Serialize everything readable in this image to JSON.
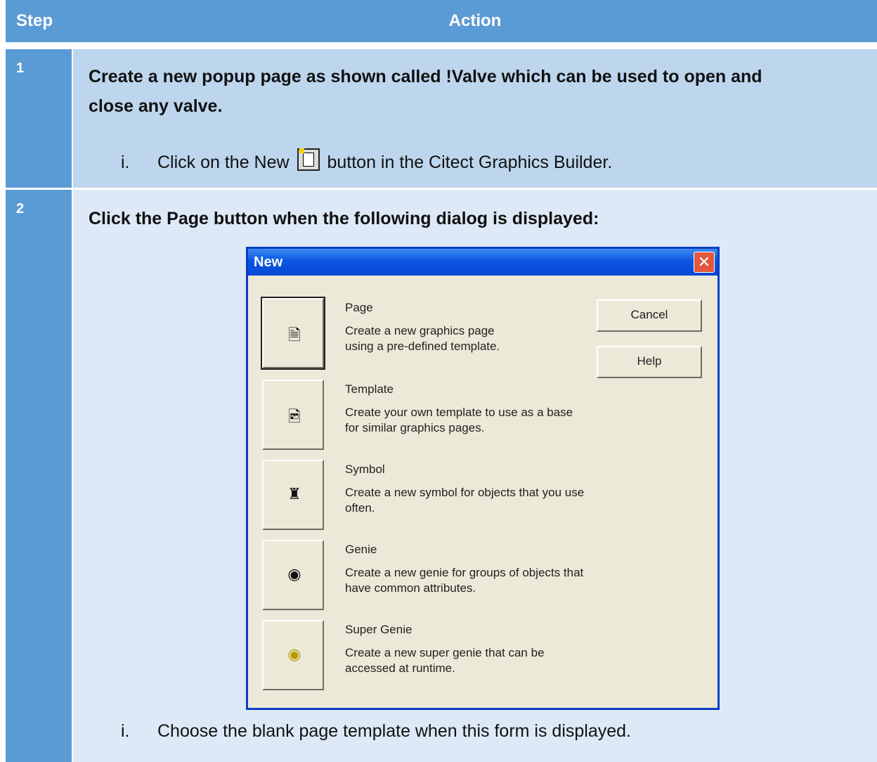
{
  "header": {
    "step_label": "Step",
    "action_label": "Action"
  },
  "steps": [
    {
      "number": "1",
      "instruction_line1": "Create a new popup page as shown called !Valve which can be used to open and",
      "instruction_line2": "close any valve.",
      "substep_roman": "i.",
      "substep_before": "Click on the New",
      "substep_icon": "new-page-icon",
      "substep_after": "button in the Citect Graphics Builder."
    },
    {
      "number": "2",
      "instruction": "Click the Page button when the following dialog is displayed:",
      "substep_roman": "i.",
      "substep_text": "Choose the blank page template when this form is displayed."
    }
  ],
  "dialog": {
    "title": "New",
    "close_glyph": "✕",
    "cancel_label": "Cancel",
    "help_label": "Help",
    "items": [
      {
        "title": "Page",
        "desc": "Create a new graphics page\nusing a pre-defined template.",
        "icon": "page-icon"
      },
      {
        "title": "Template",
        "desc": "Create your own template to use as a base\nfor similar graphics pages.",
        "icon": "template-icon"
      },
      {
        "title": "Symbol",
        "desc": "Create a new symbol for objects that you use\noften.",
        "icon": "symbol-icon"
      },
      {
        "title": "Genie",
        "desc": "Create a new genie for groups of objects that\nhave common attributes.",
        "icon": "genie-icon"
      },
      {
        "title": "Super Genie",
        "desc": "Create a new super genie that can be\naccessed at runtime.",
        "icon": "super-genie-icon"
      }
    ]
  }
}
